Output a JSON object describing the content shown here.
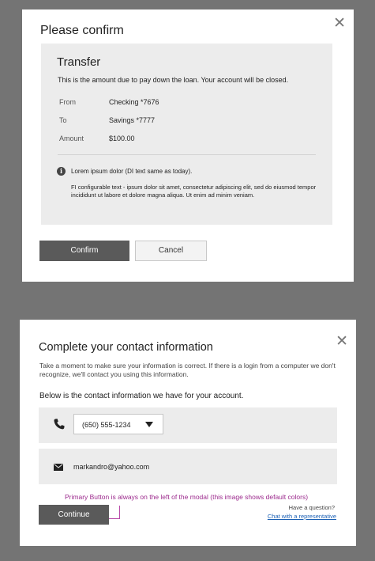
{
  "confirm_modal": {
    "title": "Please confirm",
    "close_glyph": "✕",
    "transfer": {
      "heading": "Transfer",
      "description": "This is the amount due to pay down the loan. Your account will be closed.",
      "rows": [
        {
          "label": "From",
          "value": "Checking *7676"
        },
        {
          "label": "To",
          "value": "Savings *7777"
        },
        {
          "label": "Amount",
          "value": "$100.00"
        }
      ],
      "info_icon": "info-icon",
      "info_line": "Lorem ipsum dolor (DI text same as today).",
      "info_paragraph": "FI configurable text  - ipsum dolor sit amet, consectetur adipiscing elit, sed do eiusmod tempor incididunt ut labore et dolore magna aliqua. Ut enim ad minim veniam."
    },
    "confirm_label": "Confirm",
    "cancel_label": "Cancel"
  },
  "contact_modal": {
    "title": "Complete your contact information",
    "close_glyph": "✕",
    "description": "Take a moment to make sure your information is correct. If there is a login from a computer we don't recognize, we'll contact you using this information.",
    "subheading": "Below is the contact information we have for your account.",
    "phone": {
      "icon": "phone-icon",
      "selected": "(650) 555-1234"
    },
    "email": {
      "icon": "mail-icon",
      "value": "markandro@yahoo.com"
    },
    "annotation": "Primary Button is always on the left of the modal (this image shows default colors)",
    "continue_label": "Continue",
    "question": "Have a question?",
    "chat_link": "Chat with a representative"
  },
  "colors": {
    "backdrop": "#747474",
    "primary_button": "#5a5a5a",
    "panel": "#ececec",
    "annotation": "#9c2a8d",
    "link": "#1a5fb4"
  }
}
